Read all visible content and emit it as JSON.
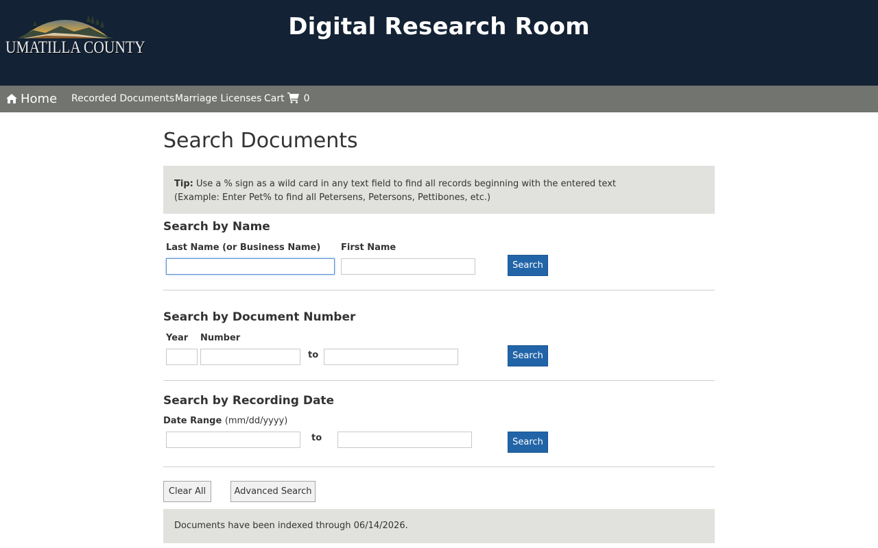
{
  "header": {
    "logo_text": "UMATILLA COUNTY",
    "title": "Digital Research Room",
    "background_color": "#132234"
  },
  "nav": {
    "home_icon": "home-icon",
    "home_label": "Home",
    "recorded_documents_label": "Recorded Documents",
    "marriage_licenses_label": "Marriage Licenses",
    "cart_label": "Cart",
    "cart_icon": "cart-icon",
    "cart_count": "0",
    "background_color": "#72746f"
  },
  "page": {
    "title": "Search Documents"
  },
  "tip": {
    "bold": "Tip:",
    "line1": "Use a % sign as a wild card in any text field to find all records beginning with the entered text",
    "line2": "(Example: Enter Pet% to find all Petersens, Petersons, Pettibones, etc.)"
  },
  "search_by_name": {
    "title": "Search by Name",
    "last_name_label": "Last Name (or Business Name)",
    "last_name_value": "",
    "first_name_label": "First Name",
    "first_name_value": "",
    "search_button": "Search"
  },
  "search_by_document": {
    "title": "Search by Document Number",
    "year_label": "Year",
    "number_label": "Number",
    "year_value": "",
    "number_from_value": "",
    "to_label": "to",
    "number_to_value": "",
    "search_button": "Search"
  },
  "search_by_date": {
    "title": "Search by Recording Date",
    "date_range_label": "Date Range",
    "date_format": "(mm/dd/yyyy)",
    "from_value": "",
    "to_label": "to",
    "to_value": "",
    "search_button": "Search"
  },
  "actions": {
    "clear_all": "Clear All",
    "advanced_search": "Advanced Search"
  },
  "status": {
    "text": "Documents have been indexed through 06/14/2026."
  },
  "colors": {
    "primary_button": "#2264a8",
    "panel_background": "#e1e1de"
  }
}
